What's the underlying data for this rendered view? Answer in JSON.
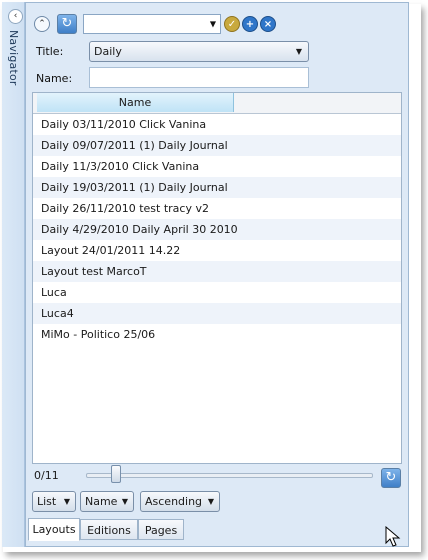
{
  "sidebar": {
    "label": "Navigator"
  },
  "toolbar": {
    "selected_value": ""
  },
  "form": {
    "title_label": "Title:",
    "title_value": "Daily",
    "name_label": "Name:",
    "name_value": ""
  },
  "grid": {
    "column_header": "Name",
    "rows": [
      "Daily 03/11/2010 Click Vanina",
      "Daily 09/07/2011 (1) Daily Journal",
      "Daily 11/3/2010 Click Vanina",
      "Daily 19/03/2011 (1) Daily Journal",
      "Daily 26/11/2010 test tracy v2",
      "Daily 4/29/2010 Daily April 30 2010",
      "Layout 24/01/2011 14.22",
      "Layout test MarcoT",
      "Luca",
      "Luca4",
      "MiMo - Politico 25/06"
    ]
  },
  "pager": {
    "count_text": "0/11"
  },
  "footer": {
    "view_label": "List",
    "sort_field_label": "Name",
    "sort_order_label": "Ascending"
  },
  "tabs": [
    "Layouts",
    "Editions",
    "Pages"
  ],
  "active_tab_index": 0,
  "colors": {
    "accent": "#3f7fc7",
    "panel_bg": "#dde9f6",
    "row_alt": "#eef3fa"
  }
}
